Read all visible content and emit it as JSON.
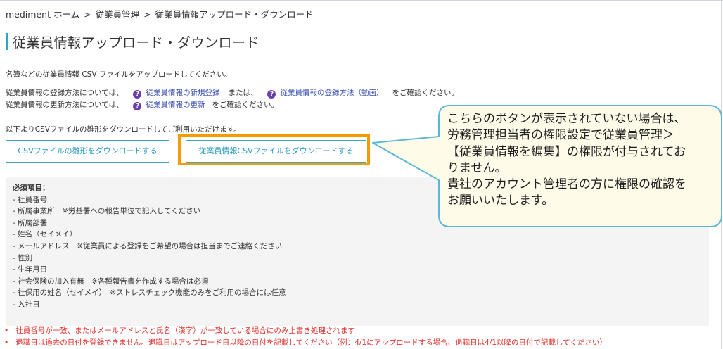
{
  "breadcrumb": {
    "items": [
      "mediment ホーム",
      "従業員管理",
      "従業員情報アップロード・ダウンロード"
    ],
    "separator": ">"
  },
  "page_title": "従業員情報アップロード・ダウンロード",
  "intro": "名簿などの従業員情報 CSV ファイルをアップロードしてください。",
  "register_line": {
    "prefix": "従業員情報の登録方法については、",
    "link1": "従業員情報の新規登録",
    "middle": "または、",
    "link2": "従業員情報の登録方法（動画）",
    "suffix": "をご確認ください。"
  },
  "update_line": {
    "prefix": "従業員情報の更新方法については、",
    "link1": "従業員情報の更新",
    "suffix": "をご確認ください。"
  },
  "template_note": "以下よりCSVファイルの雛形をダウンロードしてご利用いただけます。",
  "buttons": {
    "template_download": "CSVファイルの雛形をダウンロードする",
    "employee_download": "従業員情報CSVファイルをダウンロードする"
  },
  "required": {
    "heading": "必須項目：",
    "items": [
      "- 社員番号",
      "- 所属事業所　※労基署への報告単位で記入してください",
      "- 所属部署",
      "- 姓名（セイメイ）",
      "- メールアドレス　※従業員による登録をご希望の場合は担当までご連絡ください",
      "- 性別",
      "- 生年月日",
      "- 社会保険の加入有無　※各種報告書を作成する場合は必須",
      "- 社保用の姓名（セイメイ）　※ストレスチェック機能のみをご利用の場合には任意",
      "- 入社日"
    ]
  },
  "notes": [
    "社員番号が一致、またはメールアドレスと氏名（漢字）が一致している場合にのみ上書き処理されます",
    "退職日は過去の日付を登録できません。退職日はアップロード日以降の日付を記載してください（例：4/1にアップロードする場合、退職日は4/1以降の日付で記載してください）"
  ],
  "callout": {
    "lines": [
      "こちらのボタンが表示されていない場合は、",
      "労務管理担当者の権限設定で従業員管理＞",
      "【従業員情報を編集】の権限が付与されてお",
      "りません。",
      "貴社のアカウント管理者の方に権限の確認を",
      "お願いいたします。"
    ]
  },
  "colors": {
    "accent": "#2aa6c9",
    "button_border": "#39a6c3",
    "highlight": "#f49b00",
    "callout_bg": "#fefbe8",
    "callout_border": "#5bb8d9",
    "note_red": "#e0322e",
    "help_icon": "#6a3fa8"
  },
  "icons": [
    "help-icon"
  ]
}
